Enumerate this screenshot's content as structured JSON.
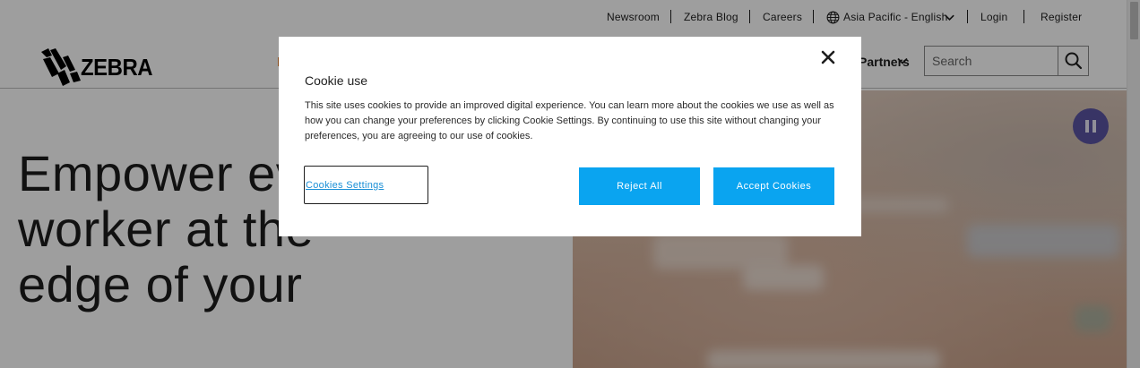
{
  "utility_nav": {
    "newsroom": "Newsroom",
    "blog": "Zebra Blog",
    "careers": "Careers",
    "region": "Asia Pacific - English",
    "login": "Login",
    "register": "Register"
  },
  "header": {
    "logo_text": "ZEBRA",
    "nav_partners": "Partners",
    "search_placeholder": "Search"
  },
  "hero": {
    "headline_line1": "Empower every",
    "headline_line2": "worker at the",
    "headline_line3": "edge of your"
  },
  "cookie_dialog": {
    "title": "Cookie use",
    "body": "This site uses cookies to provide an improved digital experience. You can learn more about the cookies we use as well as how you can change your preferences by clicking Cookie Settings. By continuing to use this site without changing your preferences, you are agreeing to our use of cookies.",
    "settings_label": "Cookies Settings",
    "reject_label": "Reject All",
    "accept_label": "Accept Cookies"
  },
  "colors": {
    "accent_blue": "#0aa4f0",
    "link_blue": "#1a8fd6",
    "pause_purple": "#5b54a3",
    "nav_accent_orange": "#d7782b"
  },
  "icons": {
    "globe": "globe-icon",
    "chevron": "chevron-down-icon",
    "search": "search-icon",
    "pause": "pause-icon",
    "close": "close-icon"
  }
}
